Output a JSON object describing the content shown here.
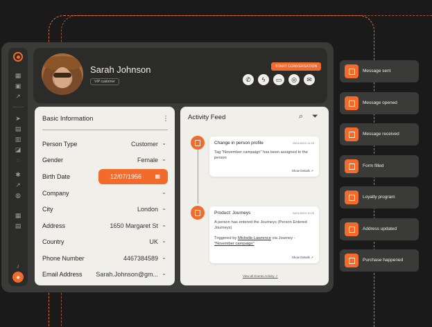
{
  "profile": {
    "name": "Sarah Johnson",
    "badge": "VIP customer",
    "start_button": "START CONVERSATION",
    "socials": [
      "whatsapp-icon",
      "messenger-icon",
      "chat-icon",
      "instagram-icon",
      "email-icon"
    ]
  },
  "basic_info": {
    "title": "Basic Information",
    "fields": [
      {
        "label": "Person Type",
        "value": "Customer"
      },
      {
        "label": "Gender",
        "value": "Female"
      },
      {
        "label": "Birth Date",
        "value": "12/07/1956"
      },
      {
        "label": "Company",
        "value": ""
      },
      {
        "label": "City",
        "value": "London"
      },
      {
        "label": "Address",
        "value": "1650 Margaret St"
      },
      {
        "label": "Country",
        "value": "UK"
      },
      {
        "label": "Phone Number",
        "value": "4467384589"
      },
      {
        "label": "Email Address",
        "value": "Sarah.Johnson@gm..."
      }
    ]
  },
  "activity": {
    "title": "Activity Feed",
    "events": [
      {
        "title": "Change in person profile",
        "timestamp": "25/01/2023 14:20",
        "description": "Tag \"November campaign\" has been assigned to the person",
        "link": "Show Details"
      },
      {
        "title": "Product: Journeys",
        "timestamp": "24/01/2023 10:25",
        "description": "A person has entered the Journeys (Person Entered Journeys)",
        "trigger_prefix": "Triggered by",
        "trigger_user": "Michelle Lawrence",
        "trigger_mid": "via Journey -",
        "trigger_campaign": "\"November campaign\"",
        "link": "Show Details"
      }
    ],
    "view_all": "View all Events Activity"
  },
  "tags": [
    {
      "label": "Message sent",
      "icon": "message-sent-icon"
    },
    {
      "label": "Message opened",
      "icon": "message-opened-icon"
    },
    {
      "label": "Message received",
      "icon": "message-received-icon"
    },
    {
      "label": "Form filled",
      "icon": "form-icon"
    },
    {
      "label": "Loyalty program",
      "icon": "loyalty-icon"
    },
    {
      "label": "Address updated",
      "icon": "location-icon"
    },
    {
      "label": "Purchase happened",
      "icon": "cart-icon"
    }
  ],
  "colors": {
    "accent": "#f26b2c",
    "background": "#1a1a1a",
    "panel": "#3a3a38",
    "card": "#f0efea"
  }
}
